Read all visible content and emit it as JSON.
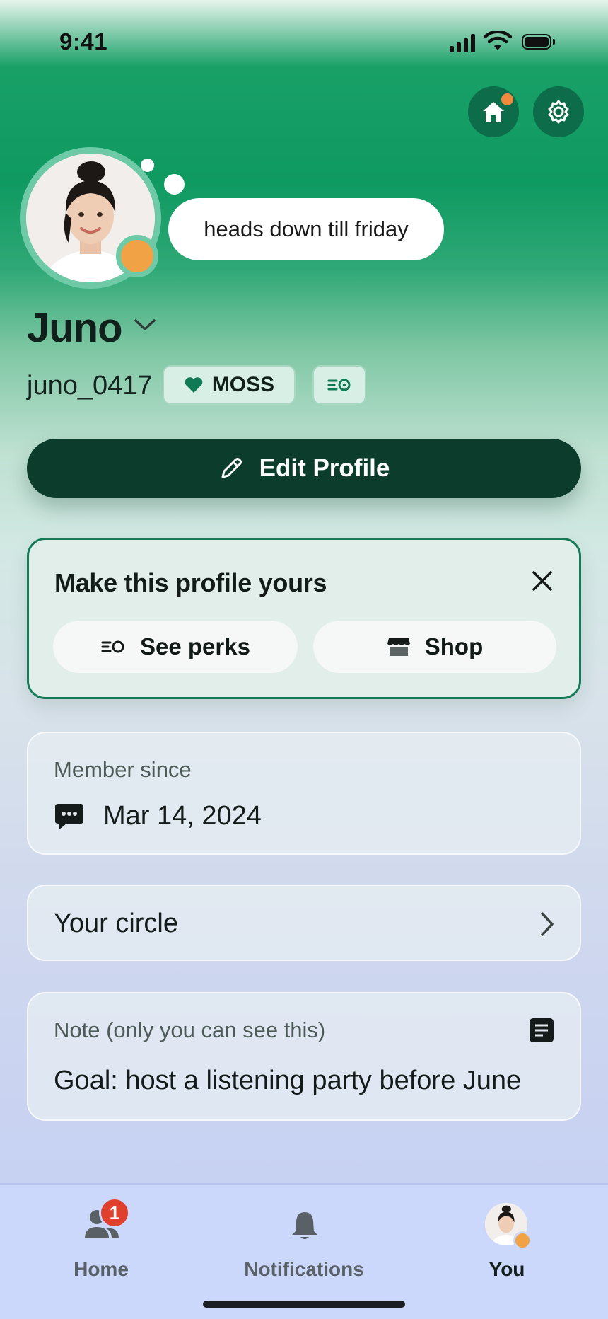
{
  "status_bar": {
    "time": "9:41"
  },
  "header": {
    "home_button": "home-icon",
    "settings_button": "gear-icon"
  },
  "profile": {
    "status_message": "heads down till friday",
    "display_name": "Juno",
    "username": "juno_0417",
    "badge_label": "MOSS",
    "edit_button_label": "Edit Profile",
    "presence_color": "#f0a244"
  },
  "promo": {
    "title": "Make this profile yours",
    "perks_label": "See perks",
    "shop_label": "Shop"
  },
  "member_card": {
    "label": "Member since",
    "date": "Mar 14, 2024"
  },
  "circle_card": {
    "label": "Your circle"
  },
  "note_card": {
    "label": "Note (only you can see this)",
    "text": "Goal: host a listening party before June"
  },
  "tabbar": {
    "tabs": [
      {
        "label": "Home",
        "icon": "friends-icon",
        "badge": "1"
      },
      {
        "label": "Notifications",
        "icon": "bell-icon"
      },
      {
        "label": "You",
        "icon": "avatar"
      }
    ]
  },
  "colors": {
    "accent": "#0f9a62",
    "dark_green": "#0b3c2c",
    "badge_red": "#e0412f",
    "notification_dot": "#f08a3e"
  }
}
